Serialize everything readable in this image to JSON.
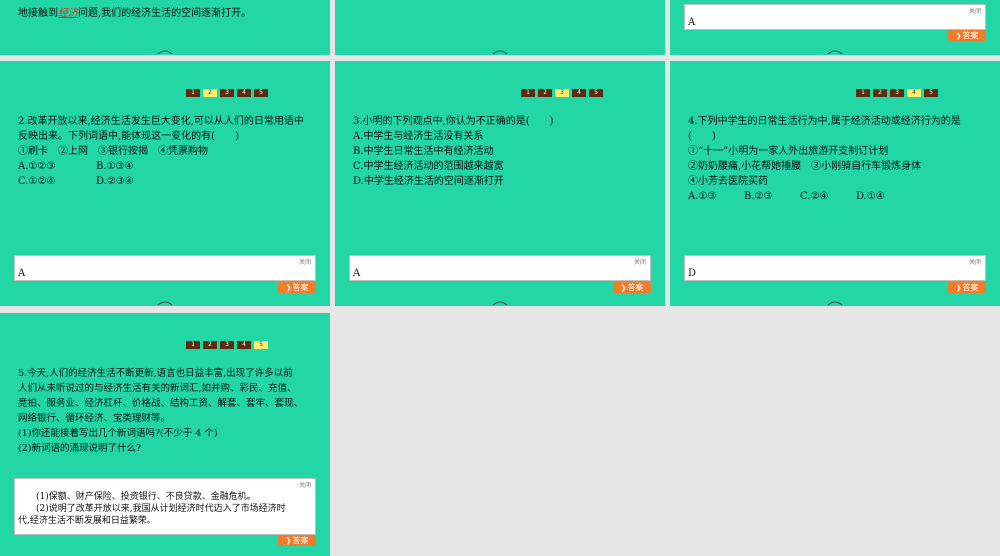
{
  "pager_labels": [
    "1",
    "2",
    "3",
    "4",
    "5"
  ],
  "top_row": {
    "s1_text_before": "地接触到",
    "s1_text_hl": "经济",
    "s1_text_after": "问题,我们的经济生活的空间逐渐打开。",
    "s3_answer": "A",
    "close_label": "关闭",
    "answer_btn": "答案"
  },
  "q2": {
    "lines": [
      "2.改革开放以来,经济生活发生巨大变化,可以从人们的日常用语中",
      "反映出来。下列词语中,能体现这一变化的有(　　)",
      "①刷卡　②上网　③银行按揭　④凭票购物"
    ],
    "opts1": [
      "A.①②③",
      "B.①③④"
    ],
    "opts2": [
      "C.①②④",
      "D.②③④"
    ],
    "answer": "A"
  },
  "q3": {
    "lines": [
      "3.小明的下列观点中,你认为不正确的是(　　)",
      "A.中学生与经济生活没有关系",
      "B.中学生日常生活中有经济活动",
      "C.中学生经济活动的范围越来越宽",
      "D.中学生经济生活的空间逐渐打开"
    ],
    "answer": "A"
  },
  "q4": {
    "lines": [
      "4.下列中学生的日常生活行为中,属于经济活动或经济行为的是",
      "(　　)",
      "①“十一”小明为一家人外出旅游开支制订计划",
      "②奶奶腰痛,小花帮她捶腰　③小刚骑自行车锻炼身体",
      "④小芳去医院买药"
    ],
    "opts": [
      "A.①③",
      "B.②③",
      "C.②④",
      "D.①④"
    ],
    "answer": "D"
  },
  "q5": {
    "lines": [
      "5.今天,人们的经济生活不断更新,语言也日益丰富,出现了许多以前",
      "人们从未听说过的与经济生活有关的新词汇,如并购、彩民、充值、",
      "竞拍、服务业、经济杠杆、价格战、结构工资、解套、套牢、套现、",
      "网络银行、循环经济、宝类理财等。",
      "(1)你还能接着写出几个新词语吗?(不少于 4 个)",
      "(2)新词语的涌现说明了什么?"
    ],
    "answer_lines": [
      "　　(1)保额、财产保险、投资银行、不良贷款、金融危机。",
      "　　(2)说明了改革开放以来,我国从计划经济时代迈入了市场经济时",
      "代,经济生活不断发展和日益繁荣。"
    ]
  }
}
